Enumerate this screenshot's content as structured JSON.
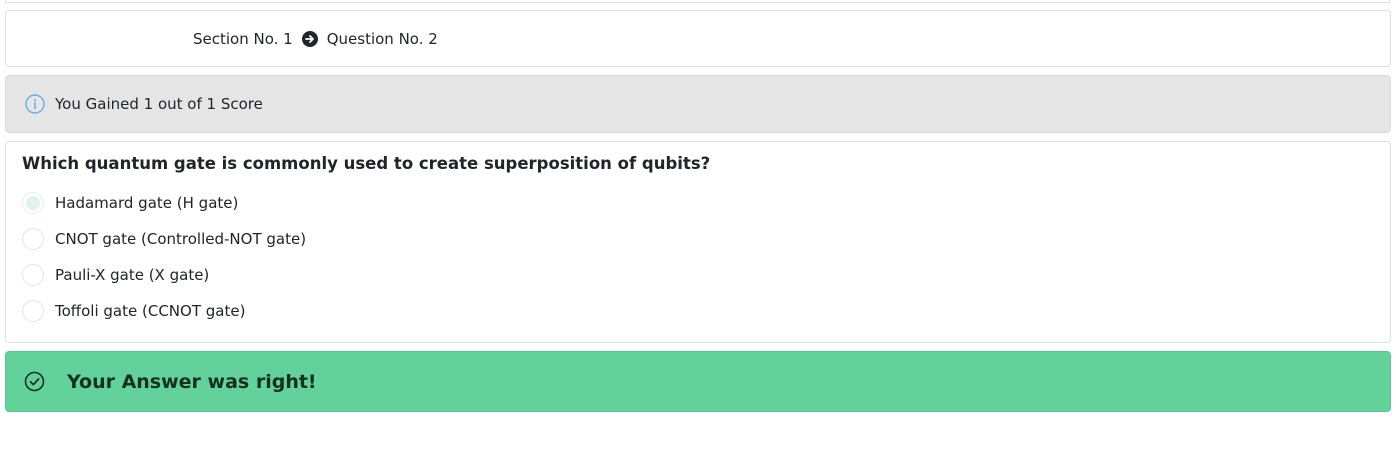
{
  "breadcrumb": {
    "section": "Section No. 1",
    "question": "Question No. 2",
    "separator_icon": "arrow-circle-right-icon"
  },
  "score_alert": {
    "icon": "info-circle-icon",
    "text": "You Gained 1 out of 1 Score"
  },
  "question": {
    "title": "Which quantum gate is commonly used to create superposition of qubits?",
    "options": [
      {
        "label": "Hadamard gate (H gate)",
        "selected": true
      },
      {
        "label": "CNOT gate (Controlled-NOT gate)",
        "selected": false
      },
      {
        "label": "Pauli-X gate (X gate)",
        "selected": false
      },
      {
        "label": "Toffoli gate (CCNOT gate)",
        "selected": false
      }
    ]
  },
  "result_alert": {
    "icon": "check-circle-icon",
    "text": "Your Answer was right!"
  },
  "colors": {
    "info_bg": "#e5e5e5",
    "info_icon": "#6aaee6",
    "success_bg": "#63d19a",
    "success_text": "#16301f"
  }
}
